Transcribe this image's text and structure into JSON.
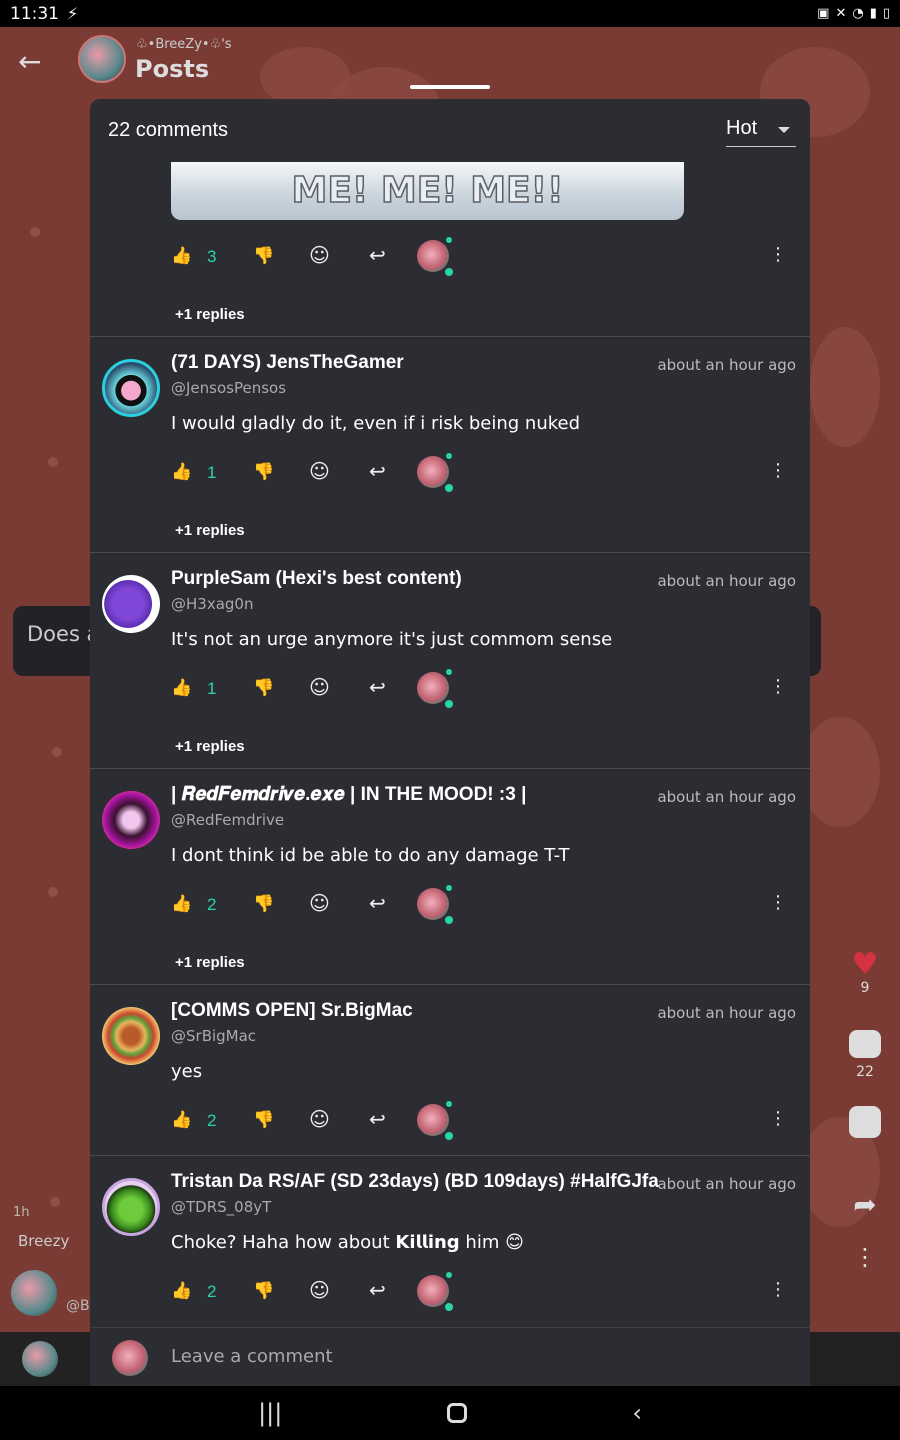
{
  "status": {
    "time": "11:31"
  },
  "header": {
    "user_tag": "♧•BreeZy•♧'s",
    "title": "Posts"
  },
  "background_post": {
    "text_preview": "Does a",
    "age": "1h",
    "author": "Breezy",
    "handle": "@B",
    "likes": "9",
    "comments": "22"
  },
  "sheet": {
    "count_label": "22 comments",
    "sort_label": "Hot",
    "image_caption": "ME! ME! ME!!",
    "first_comment": {
      "likes": "3",
      "replies": "+1 replies"
    },
    "comments": [
      {
        "name": "(71 DAYS) JensTheGamer",
        "handle": "@JensosPensos",
        "time": "about an hour ago",
        "text": "I would gladly do it, even if i risk being nuked",
        "likes": "1",
        "replies": "+1 replies"
      },
      {
        "name": "PurpleSam (Hexi's best content)",
        "handle": "@H3xag0n",
        "time": "about an hour ago",
        "text": "It's not an urge anymore it's just commom sense",
        "likes": "1",
        "replies": "+1 replies"
      },
      {
        "name": "| 𝑹𝒆𝒅𝑭𝒆𝒎𝒅𝒓𝒊𝒗𝒆.𝒆𝒙𝒆 | IN THE MOOD! :3 |",
        "handle": "@RedFemdrive",
        "time": "about an hour ago",
        "text": "I dont think id be able to do any damage T-T",
        "likes": "2",
        "replies": "+1 replies"
      },
      {
        "name": "[COMMS OPEN] Sr.BigMac",
        "handle": "@SrBigMac",
        "time": "about an hour ago",
        "text": "yes",
        "likes": "2"
      },
      {
        "name": "Tristan Da RS/AF (SD 23days) (BD 109days) #HalfGJfa",
        "handle": "@TDRS_08yT",
        "time": "about an hour ago",
        "text": "Choke? Haha how about 𝗞𝗶𝗹𝗹𝗶𝗻𝗴 him 😊",
        "likes": "2"
      }
    ],
    "compose_placeholder": "Leave a comment"
  }
}
